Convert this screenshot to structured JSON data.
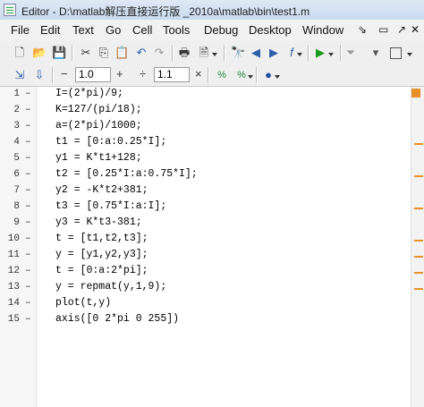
{
  "window": {
    "title": "Editor - D:\\matlab解压直接运行版 _2010a\\matlab\\bin\\test1.m"
  },
  "menu": [
    "File",
    "Edit",
    "Text",
    "Go",
    "Cell",
    "Tools",
    "Debug",
    "Desktop",
    "Window"
  ],
  "toolbar2": {
    "minus": "−",
    "value1": "1.0",
    "plus": "+",
    "divide": "÷",
    "value2": "1.1",
    "times": "×"
  },
  "code": {
    "lines": [
      {
        "n": "1",
        "text": "I=(2*pi)/9;"
      },
      {
        "n": "2",
        "text": "K=127/(pi/18);"
      },
      {
        "n": "3",
        "text": "a=(2*pi)/1000;"
      },
      {
        "n": "4",
        "text": "t1 = [0:a:0.25*I];"
      },
      {
        "n": "5",
        "text": "y1 = K*t1+128;"
      },
      {
        "n": "6",
        "text": "t2 = [0.25*I:a:0.75*I];"
      },
      {
        "n": "7",
        "text": "y2 = -K*t2+381;"
      },
      {
        "n": "8",
        "text": "t3 = [0.75*I:a:I];"
      },
      {
        "n": "9",
        "text": "y3 = K*t3-381;"
      },
      {
        "n": "10",
        "text": "t = [t1,t2,t3];"
      },
      {
        "n": "11",
        "text": "y = [y1,y2,y3];"
      },
      {
        "n": "12",
        "text": "t = [0:a:2*pi];"
      },
      {
        "n": "13",
        "text": "y = repmat(y,1,9);"
      },
      {
        "n": "14",
        "text": "plot(t,y)"
      },
      {
        "n": "15",
        "text": "axis([0 2*pi 0 255])"
      }
    ],
    "dash": "–"
  },
  "colors": {
    "warning_marker": "#e8912a"
  }
}
